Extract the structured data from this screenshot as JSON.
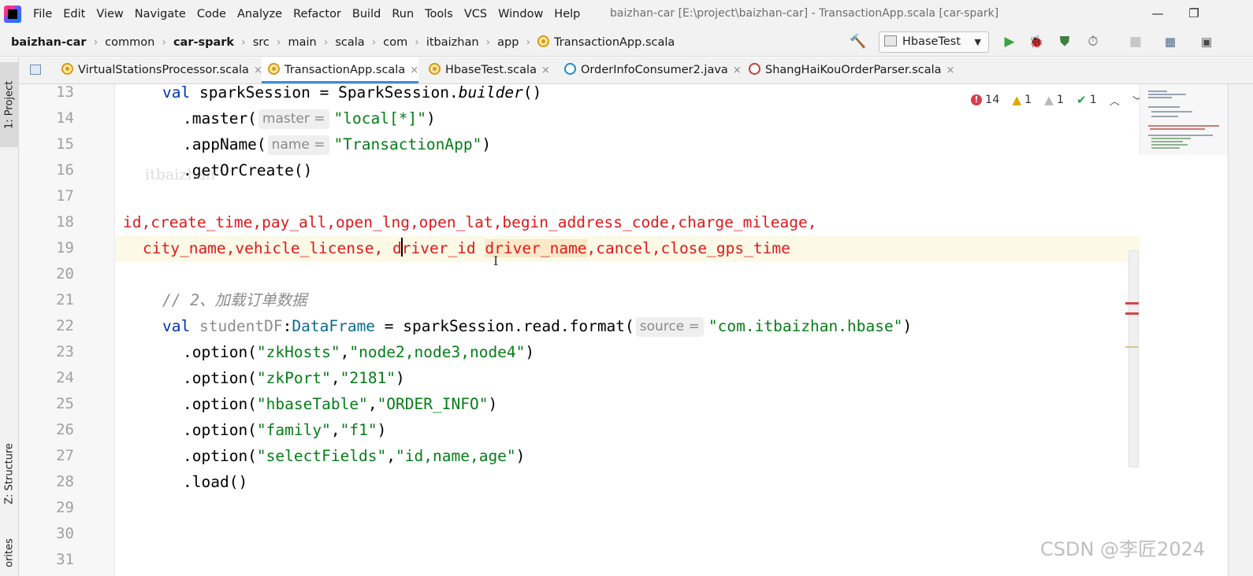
{
  "menu": [
    "File",
    "Edit",
    "View",
    "Navigate",
    "Code",
    "Analyze",
    "Refactor",
    "Build",
    "Run",
    "Tools",
    "VCS",
    "Window",
    "Help"
  ],
  "window_title": "baizhan-car [E:\\project\\baizhan-car] - TransactionApp.scala [car-spark]",
  "window_controls": {
    "minimize": "—",
    "restore": "❐"
  },
  "breadcrumbs": [
    "baizhan-car",
    "common",
    "car-spark",
    "src",
    "main",
    "scala",
    "com",
    "itbaizhan",
    "app",
    "TransactionApp.scala"
  ],
  "run_config": "HbaseTest",
  "toolbar_icons": {
    "build": "🔨",
    "run": "▶",
    "debug": "🐞",
    "coverage": "⛊",
    "profile": "⏱",
    "stop": "■"
  },
  "tabs": [
    {
      "label": "VirtualStationsProcessor.scala",
      "close": "×"
    },
    {
      "label": "TransactionApp.scala",
      "close": "×"
    },
    {
      "label": "HbaseTest.scala",
      "close": "×"
    },
    {
      "label": "OrderInfoConsumer2.java",
      "close": "×"
    },
    {
      "label": "ShangHaiKouOrderParser.scala",
      "close": "×"
    }
  ],
  "tool_windows": {
    "project": "1: Project",
    "structure": "Z: Structure",
    "favorites": "orites"
  },
  "inspections": {
    "errors": "14",
    "warnings": "1",
    "weak_warnings": "1",
    "typos": "1"
  },
  "line_numbers": [
    "13",
    "14",
    "15",
    "16",
    "17",
    "18",
    "19",
    "20",
    "21",
    "22",
    "23",
    "24",
    "25",
    "26",
    "27",
    "28",
    "29",
    "30",
    "31"
  ],
  "code": {
    "l13": {
      "kw": "val",
      "a": " sparkSession = SparkSession.",
      "b": "builder",
      "c": "()"
    },
    "l14": {
      "a": ".master(",
      "hint": "master =",
      "str": "\"local[*]\"",
      "c": ")"
    },
    "l15": {
      "a": ".appName(",
      "hint": "name =",
      "str": "\"TransactionApp\"",
      "c": ")"
    },
    "l16": {
      "a": ".getOrCreate()"
    },
    "l18": {
      "text": "id,create_time,pay_all,open_lng,open_lat,begin_address_code,charge_mileage,"
    },
    "l19": {
      "a": "city_name,vehicle_license, d",
      "b": "river_id",
      "c": "driver_name",
      "d": ",cancel,close_gps_time"
    },
    "l21": {
      "comment": "// 2、加载订单数据"
    },
    "l22": {
      "kw": "val",
      "name": " studentDF",
      "colon": ":",
      "type": "DataFrame",
      "a": " = sparkSession.read.format(",
      "hint": "source =",
      "str": "\"com.itbaizhan.hbase\"",
      "c": ")"
    },
    "l23": {
      "a": ".option(",
      "s1": "\"zkHosts\"",
      "sep": ",",
      "s2": "\"node2,node3,node4\"",
      "c": ")"
    },
    "l24": {
      "a": ".option(",
      "s1": "\"zkPort\"",
      "sep": ",",
      "s2": "\"2181\"",
      "c": ")"
    },
    "l25": {
      "a": ".option(",
      "s1": "\"hbaseTable\"",
      "sep": ",",
      "s2": "\"ORDER_INFO\"",
      "c": ")"
    },
    "l26": {
      "a": ".option(",
      "s1": "\"family\"",
      "sep": ",",
      "s2": "\"f1\"",
      "c": ")"
    },
    "l27": {
      "a": ".option(",
      "s1": "\"selectFields\"",
      "sep": ",",
      "s2": "\"id,name,age\"",
      "c": ")"
    },
    "l28": {
      "a": ".load()"
    }
  },
  "watermark": "itbaizhan",
  "corner_watermark": "CSDN @李匠2024",
  "colors": {
    "keyword": "#0033b3",
    "string": "#067d17",
    "error": "#e01919",
    "comment": "#8c8c8c",
    "accent": "#3d8bde"
  }
}
